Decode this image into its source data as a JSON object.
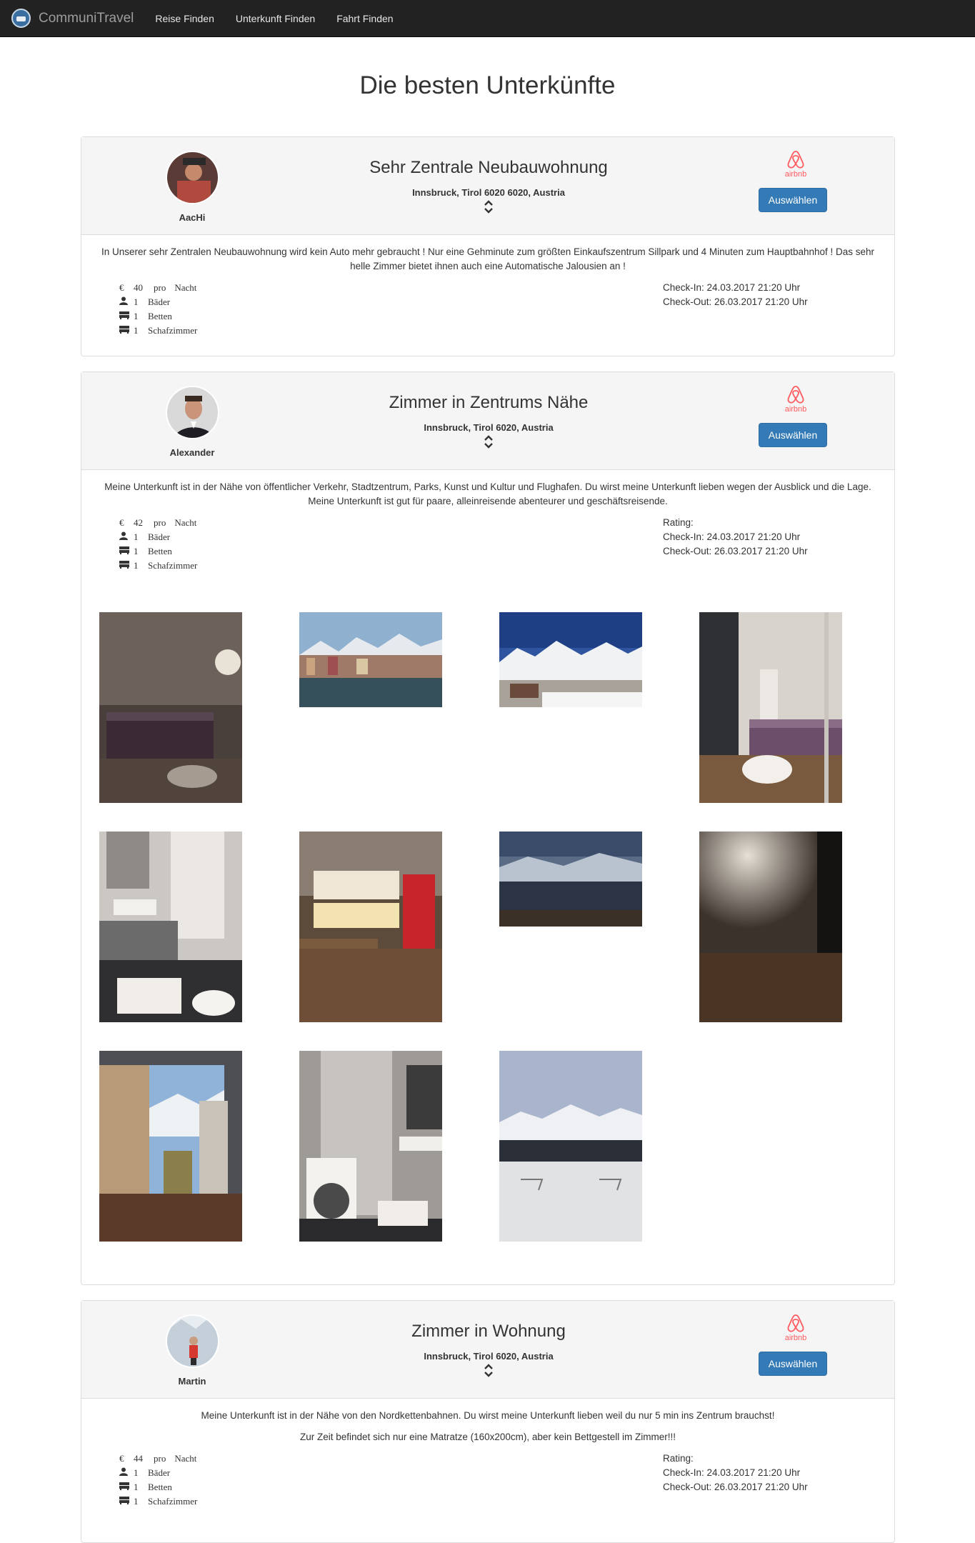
{
  "nav": {
    "brand": "CommuniTravel",
    "links": [
      "Reise Finden",
      "Unterkunft Finden",
      "Fahrt Finden"
    ]
  },
  "page_title": "Die besten Unterkünfte",
  "listings": [
    {
      "host": "AacHi",
      "title": "Sehr Zentrale Neubauwohnung",
      "address": "Innsbruck, Tirol 6020 6020, Austria",
      "provider": "airbnb",
      "select_label": "Auswählen",
      "description": [
        "In Unserer sehr Zentralen Neubauwohnung wird kein Auto mehr gebraucht ! Nur eine Gehminute zum größten Einkaufszentrum Sillpark und 4 Minuten zum Hauptbahnhof ! Das sehr helle Zimmer bietet ihnen auch eine Automatische Jalousien an !"
      ],
      "price_symbol": "€",
      "price": "40",
      "price_pro": "pro",
      "price_unit": "Nacht",
      "baths": "1",
      "baths_label": "Bäder",
      "beds": "1",
      "beds_label": "Betten",
      "bedrooms": "1",
      "bedrooms_label": "Schafzimmer",
      "checkin": "Check-In: 24.03.2017 21:20 Uhr",
      "checkout": "Check-Out: 26.03.2017 21:20 Uhr"
    },
    {
      "host": "Alexander",
      "title": "Zimmer in Zentrums Nähe",
      "address": "Innsbruck, Tirol 6020, Austria",
      "provider": "airbnb",
      "select_label": "Auswählen",
      "description": [
        "Meine Unterkunft ist in der Nähe von öffentlicher Verkehr, Stadtzentrum, Parks, Kunst und Kultur und Flughafen. Du wirst meine Unterkunft lieben wegen der Ausblick und die Lage. Meine Unterkunft ist gut für paare, alleinreisende abenteurer und geschäftsreisende."
      ],
      "price_symbol": "€",
      "price": "42",
      "price_pro": "pro",
      "price_unit": "Nacht",
      "baths": "1",
      "baths_label": "Bäder",
      "beds": "1",
      "beds_label": "Betten",
      "bedrooms": "1",
      "bedrooms_label": "Schafzimmer",
      "rating": "Rating:",
      "checkin": "Check-In: 24.03.2017 21:20 Uhr",
      "checkout": "Check-Out: 26.03.2017 21:20 Uhr"
    },
    {
      "host": "Martin",
      "title": "Zimmer in Wohnung",
      "address": "Innsbruck, Tirol 6020, Austria",
      "provider": "airbnb",
      "select_label": "Auswählen",
      "description": [
        "Meine Unterkunft ist in der Nähe von den Nordkettenbahnen. Du wirst meine Unterkunft lieben weil du nur 5 min ins Zentrum brauchst!",
        "Zur Zeit befindet sich nur eine Matratze (160x200cm), aber kein Bettgestell im Zimmer!!!"
      ],
      "price_symbol": "€",
      "price": "44",
      "price_pro": "pro",
      "price_unit": "Nacht",
      "baths": "1",
      "baths_label": "Bäder",
      "beds": "1",
      "beds_label": "Betten",
      "bedrooms": "1",
      "bedrooms_label": "Schafzimmer",
      "rating": "Rating:",
      "checkin": "Check-In: 24.03.2017 21:20 Uhr",
      "checkout": "Check-Out: 26.03.2017 21:20 Uhr"
    }
  ],
  "icons": {
    "brand": "brand-logo-icon",
    "provider": "airbnb-logo-icon",
    "toggle": "chevron-up-down-icon",
    "price": "euro-icon",
    "baths": "user-icon",
    "beds": "bed-icon",
    "bedrooms": "bed-icon"
  },
  "colors": {
    "navbar": "#222222",
    "button": "#337ab7",
    "airbnb": "#ff5a5f",
    "panel_header": "#f5f5f5"
  }
}
